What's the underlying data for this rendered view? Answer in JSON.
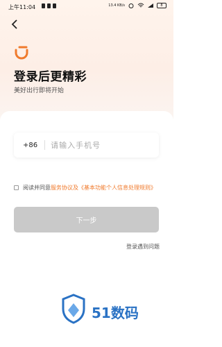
{
  "status_bar": {
    "time": "上午11:04",
    "network_rate": "13.4 KB/s",
    "battery": "8"
  },
  "header": {
    "title": "登录后更精彩",
    "subtitle": "美好出行即将开始"
  },
  "login_form": {
    "country_code": "+86",
    "phone_placeholder": "请输入手机号",
    "phone_value": "",
    "agreement_checked": false,
    "agreement_prefix": "阅读并同意",
    "service_agreement_link": "服务协议",
    "agreement_and": "及",
    "privacy_policy_link": "《基本功能个人信息处理规则》",
    "next_button": "下一步",
    "problem_link": "登录遇到问题"
  },
  "watermark": {
    "text": "51数码"
  },
  "colors": {
    "brand_orange": "#f07a2c",
    "button_disabled": "#c9c9c9",
    "watermark_blue": "#2a72c4"
  },
  "icons": {
    "back": "chevron-left-icon",
    "logo": "didi-logo"
  }
}
